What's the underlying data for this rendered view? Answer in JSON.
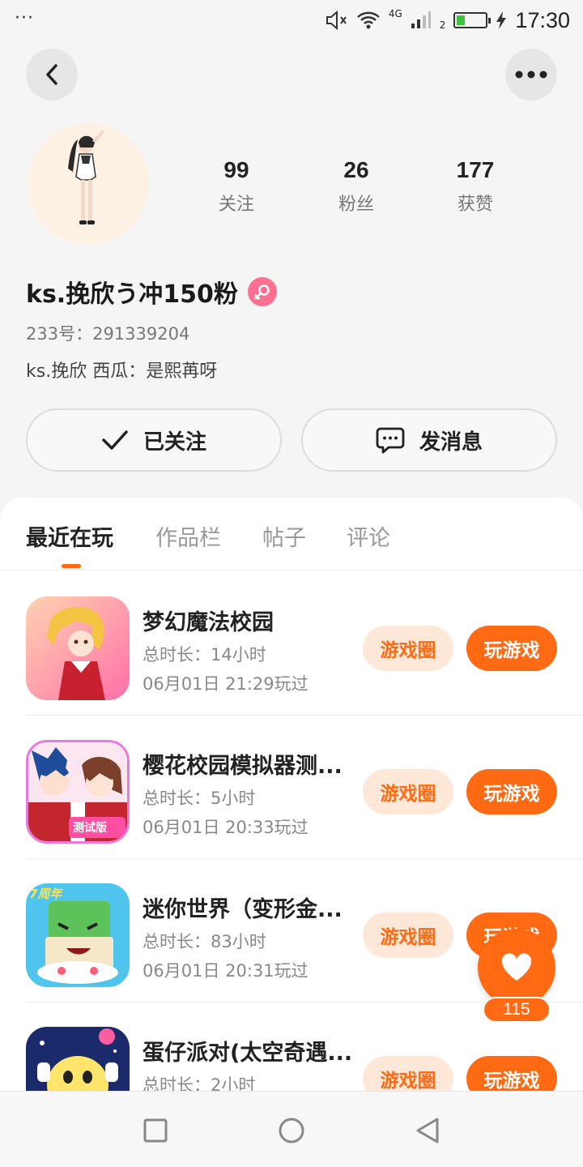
{
  "status_bar": {
    "dots": "···",
    "network": "4G",
    "sim": "2",
    "battery_level": 0.3,
    "time": "17:30"
  },
  "profile": {
    "stats": [
      {
        "value": "99",
        "label": "关注"
      },
      {
        "value": "26",
        "label": "粉丝"
      },
      {
        "value": "177",
        "label": "获赞"
      }
    ],
    "username": "ks.挽欣う冲150粉",
    "gender": "female",
    "id_line": "233号：291339204",
    "bio": "ks.挽欣  西瓜：是熙苒呀"
  },
  "actions": {
    "follow_label": "已关注",
    "message_label": "发消息"
  },
  "tabs": [
    "最近在玩",
    "作品栏",
    "帖子",
    "评论"
  ],
  "games": [
    {
      "title": "梦幻魔法校园",
      "duration": "总时长：14小时",
      "last_played": "06月01日 21:29玩过",
      "circle_label": "游戏圈",
      "play_label": "玩游戏"
    },
    {
      "title": "樱花校园模拟器测...",
      "duration": "总时长：5小时",
      "last_played": "06月01日 20:33玩过",
      "circle_label": "游戏圈",
      "play_label": "玩游戏",
      "icon_badge": "测试版"
    },
    {
      "title": "迷你世界（变形金...",
      "duration": "总时长：83小时",
      "last_played": "06月01日 20:31玩过",
      "circle_label": "游戏圈",
      "play_label": "玩游戏",
      "icon_badge": "7周年"
    },
    {
      "title": "蛋仔派对(太空奇遇...",
      "duration": "总时长：2小时",
      "last_played": "",
      "circle_label": "游戏圈",
      "play_label": "玩游戏"
    }
  ],
  "like": {
    "count": "115"
  },
  "colors": {
    "accent": "#ff6a13",
    "accent_light": "#ffe8d8",
    "female": "#ff6f91"
  }
}
